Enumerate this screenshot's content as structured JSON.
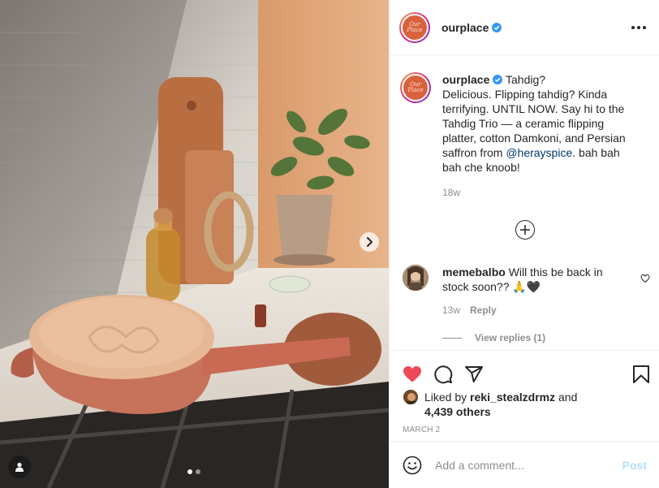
{
  "post": {
    "username": "ourplace",
    "avatar_text": "Our Place",
    "caption_lines": [
      "Tahdig?",
      "Delicious. Flipping tahdig? Kinda terrifying. UNTIL NOW. Say hi to the Tahdig Trio — a ceramic flipping platter, cotton Damkoni, and Persian saffron from "
    ],
    "caption_mention": "@herayspice",
    "caption_tail": ". bah bah bah che knoob!",
    "caption_time": "18w",
    "carousel": {
      "total": 2,
      "active": 1
    }
  },
  "comment": {
    "username": "memebalbo",
    "text": "Will this be back in stock soon?? 🙏🖤",
    "time": "13w",
    "reply_label": "Reply",
    "view_replies": "View replies (1)"
  },
  "likes": {
    "liked_by_prefix": "Liked by",
    "liked_by_user": "reki_stealzdrmz",
    "and": "and",
    "others": "4,439 others"
  },
  "date": "MARCH 2",
  "add_comment": {
    "placeholder": "Add a comment...",
    "post_label": "Post"
  },
  "icons": {
    "like": "heart-filled-icon",
    "comment": "comment-bubble-icon",
    "share": "paper-plane-icon",
    "save": "bookmark-icon",
    "more": "more-options-icon",
    "emoji": "emoji-smiley-icon",
    "next": "chevron-right-icon",
    "tag": "user-tag-icon",
    "verified": "verified-badge-icon",
    "load_more": "plus-circle-icon"
  },
  "colors": {
    "like_red": "#ed4956",
    "verified_blue": "#3897f0",
    "mention": "#00376b",
    "muted": "#8e8e8e",
    "post_disabled": "#b2dffc"
  }
}
